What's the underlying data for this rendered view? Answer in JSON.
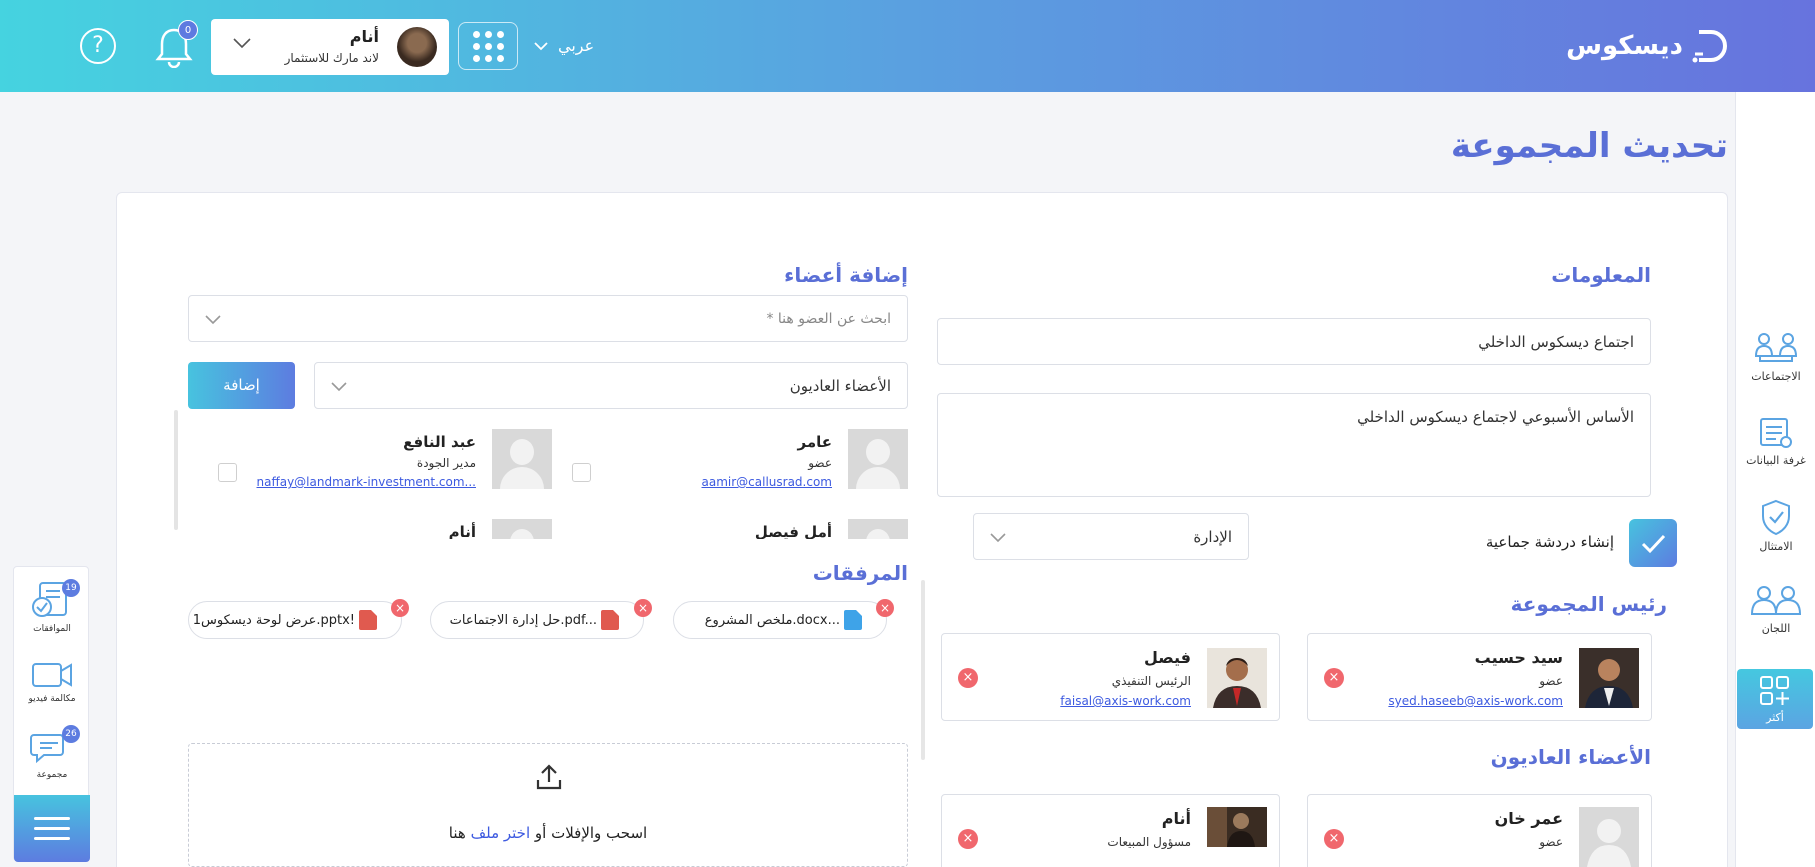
{
  "header": {
    "logo_text": "ديسكوس",
    "language": "عربي",
    "user_name": "أنام",
    "user_org": "لاند مارك للاستثمار",
    "notifications_count": "0"
  },
  "page_title": "تحديث المجموعة",
  "right_nav": [
    {
      "label": "الاجتماعات",
      "icon": "meetings-icon"
    },
    {
      "label": "غرفة البيانات",
      "icon": "data-room-icon"
    },
    {
      "label": "الامتثال",
      "icon": "compliance-icon"
    },
    {
      "label": "اللجان",
      "icon": "committees-icon"
    },
    {
      "label": "أكثر",
      "icon": "more-apps-icon"
    }
  ],
  "info": {
    "title": "المعلومات",
    "name_value": "اجتماع ديسكوس الداخلي",
    "description_value": "الأساس الأسبوعي لاجتماع ديسكوس الداخلي",
    "department_value": "الإدارة",
    "chat_label": "إنشاء دردشة جماعية",
    "chat_checked": true
  },
  "group_head": {
    "title": "رئيس المجموعة",
    "members": [
      {
        "name": "سيد حسيب",
        "role": "عضو",
        "email": "syed.haseeb@axis-work.com"
      },
      {
        "name": "فيصل",
        "role": "الرئيس التنفيذي",
        "email": "faisal@axis-work.com"
      }
    ]
  },
  "regular_members": {
    "title": "الأعضاء العاديون",
    "members": [
      {
        "name": "عمر خان",
        "role": "عضو"
      },
      {
        "name": "أنام",
        "role": "مسؤول المبيعات"
      }
    ]
  },
  "add_members": {
    "title": "إضافة أعضاء",
    "search_placeholder": "ابحث عن العضو هنا *",
    "type_value": "الأعضاء العاديون",
    "add_button": "إضافة",
    "candidates": [
      {
        "name": "عامر",
        "role": "عضو",
        "email": "aamir@callusrad.com"
      },
      {
        "name": "عبد النافع",
        "role": "مدير الجودة",
        "email": "naffay@landmark-investment.com..."
      },
      {
        "name": "أمل فيصل"
      },
      {
        "name": "أنام"
      }
    ]
  },
  "attachments": {
    "title": "المرفقات",
    "files": [
      {
        "name": "ملخص المشروع.docx...",
        "type": "DOCX",
        "color": "#3ea3e8"
      },
      {
        "name": "حل إدارة الاجتماعات.pdf...",
        "type": "PDF",
        "color": "#e05a4f"
      },
      {
        "name": "عرض لوحة ديسكوس1.pptx!",
        "type": "PPT",
        "color": "#e05a4f"
      }
    ],
    "drop_text": "اسحب والإفلات أو",
    "choose_file": "اختر ملف",
    "drop_suffix": " هنا"
  },
  "dock": [
    {
      "label": "الموافقات",
      "badge": "19",
      "icon": "approvals-icon"
    },
    {
      "label": "مكالمة فيديو",
      "icon": "video-call-icon"
    },
    {
      "label": "مجموعة",
      "badge": "26",
      "icon": "group-chat-icon"
    }
  ],
  "colors": {
    "accent": "#5a6fd6",
    "link": "#3d5ae0",
    "danger": "#f0676d"
  }
}
